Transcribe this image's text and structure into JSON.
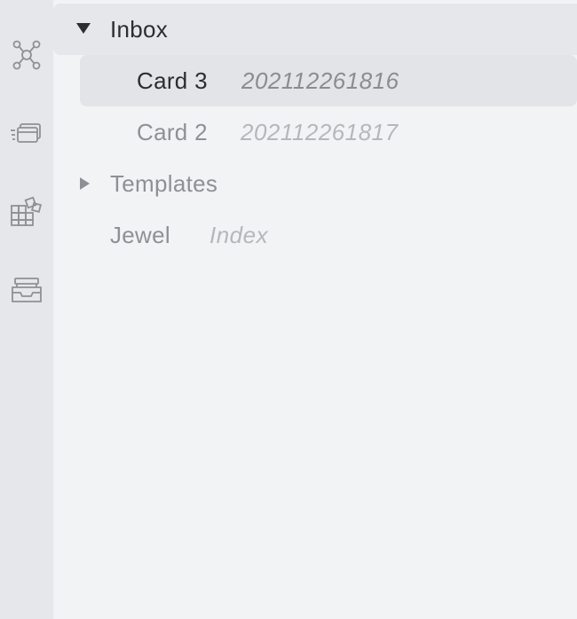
{
  "rail": {
    "icons": [
      {
        "name": "graph-icon"
      },
      {
        "name": "cards-icon"
      },
      {
        "name": "blocks-icon"
      },
      {
        "name": "inbox-tray-icon"
      }
    ],
    "icon_color": "#8f9095"
  },
  "tree": {
    "items": [
      {
        "label": "Inbox",
        "expanded": true,
        "level": 0
      },
      {
        "label": "Card 3",
        "meta": "202112261816",
        "level": 1,
        "selected": true
      },
      {
        "label": "Card 2",
        "meta": "202112261817",
        "level": 1
      },
      {
        "label": "Templates",
        "expanded": false,
        "level": 0
      },
      {
        "label": "Jewel",
        "meta": "Index",
        "level": 0
      }
    ]
  },
  "colors": {
    "background": "#f2f3f5",
    "rail": "#e6e7ea",
    "selected_row": "#e3e4e7",
    "text_primary": "#2b2d31",
    "text_secondary": "#8f9095",
    "text_muted": "#b6b7bb"
  }
}
